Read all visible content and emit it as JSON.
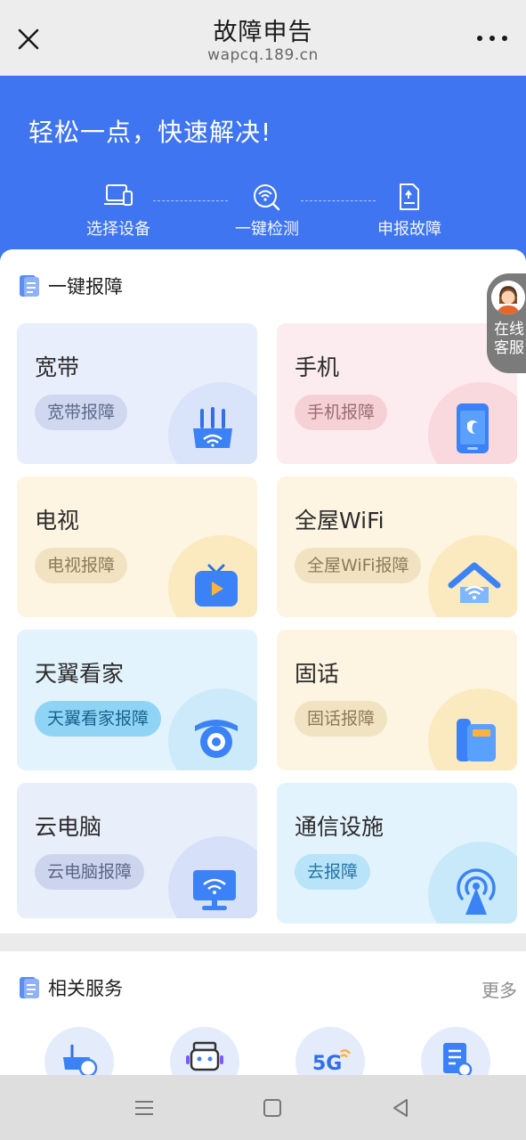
{
  "header": {
    "title": "故障申告",
    "url": "wapcq.189.cn"
  },
  "hero": {
    "slogan": "轻松一点，快速解决!",
    "steps": [
      {
        "label": "选择设备",
        "icon": "device-icon"
      },
      {
        "label": "一键检测",
        "icon": "detect-icon"
      },
      {
        "label": "申报故障",
        "icon": "report-icon"
      }
    ]
  },
  "quick_report": {
    "title": "一键报障",
    "cards": [
      {
        "name": "宽带",
        "action": "宽带报障",
        "icon": "router-icon"
      },
      {
        "name": "手机",
        "action": "手机报障",
        "icon": "phone-icon"
      },
      {
        "name": "电视",
        "action": "电视报障",
        "icon": "tv-icon"
      },
      {
        "name": "全屋WiFi",
        "action": "全屋WiFi报障",
        "icon": "wifi-house-icon"
      },
      {
        "name": "天翼看家",
        "action": "天翼看家报障",
        "icon": "camera-icon"
      },
      {
        "name": "固话",
        "action": "固话报障",
        "icon": "landline-icon"
      },
      {
        "name": "云电脑",
        "action": "云电脑报障",
        "icon": "cloud-pc-icon"
      },
      {
        "name": "通信设施",
        "action": "去报障",
        "icon": "tower-icon"
      }
    ]
  },
  "online_service": {
    "label": "在线客服"
  },
  "related": {
    "title": "相关服务",
    "more": "更多"
  },
  "colors": {
    "brand_blue": "#3f75f0",
    "icon_blue": "#2f7af3"
  }
}
